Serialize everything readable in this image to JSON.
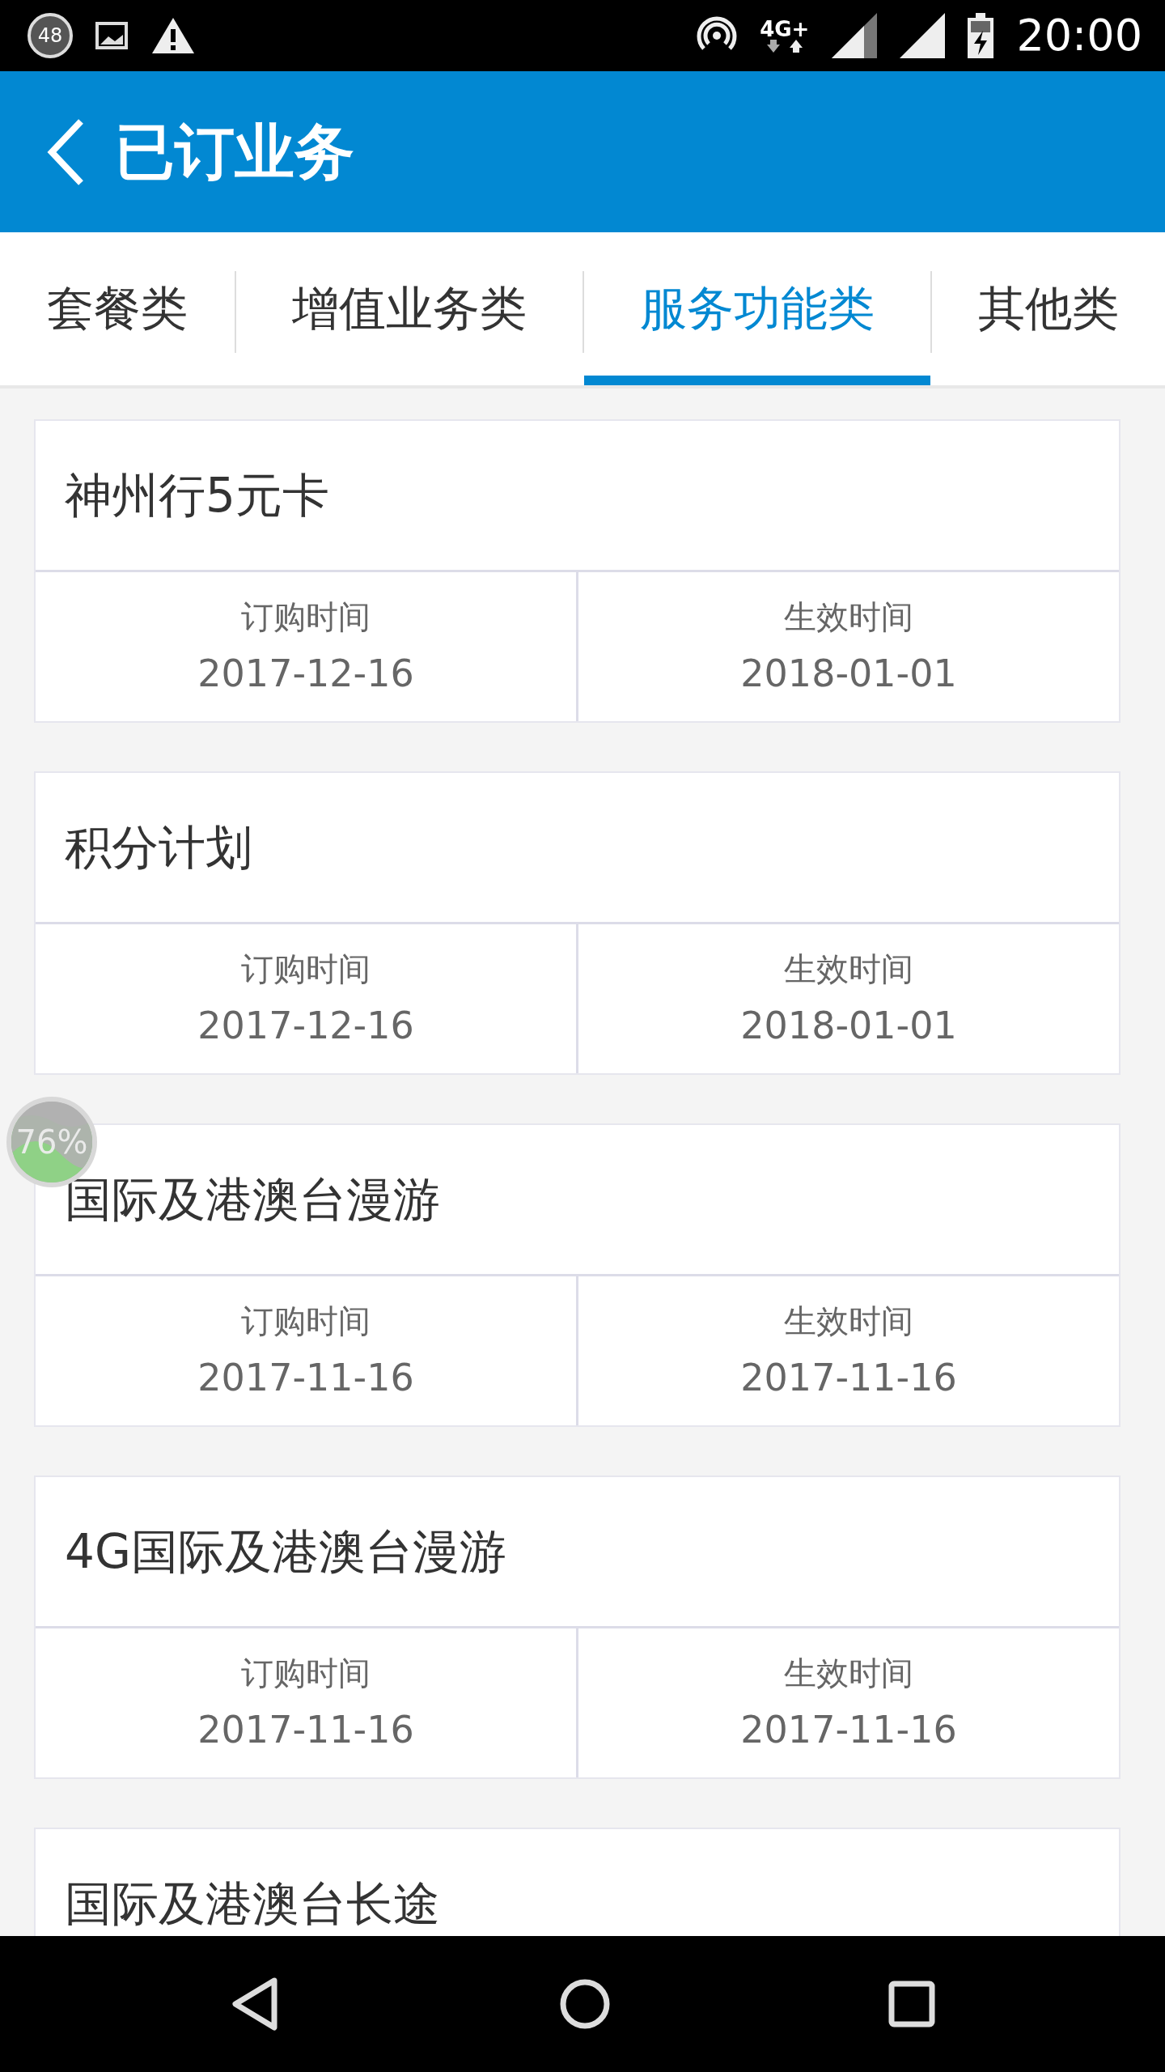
{
  "status_bar": {
    "notification_count": "48",
    "network": "4G+",
    "time": "20:00"
  },
  "header": {
    "title": "已订业务"
  },
  "tabs": [
    {
      "label": "套餐类",
      "selected": false
    },
    {
      "label": "增值业务类",
      "selected": false
    },
    {
      "label": "服务功能类",
      "selected": true
    },
    {
      "label": "其他类",
      "selected": false
    }
  ],
  "services": [
    {
      "name": "神州行5元卡",
      "order_label": "订购时间",
      "order_date": "2017-12-16",
      "effective_label": "生效时间",
      "effective_date": "2018-01-01"
    },
    {
      "name": "积分计划",
      "order_label": "订购时间",
      "order_date": "2017-12-16",
      "effective_label": "生效时间",
      "effective_date": "2018-01-01"
    },
    {
      "name": "国际及港澳台漫游",
      "order_label": "订购时间",
      "order_date": "2017-11-16",
      "effective_label": "生效时间",
      "effective_date": "2017-11-16"
    },
    {
      "name": "4G国际及港澳台漫游",
      "order_label": "订购时间",
      "order_date": "2017-11-16",
      "effective_label": "生效时间",
      "effective_date": "2017-11-16"
    },
    {
      "name": "国际及港澳台长途"
    }
  ],
  "memory_widget": {
    "reading": "76%"
  }
}
